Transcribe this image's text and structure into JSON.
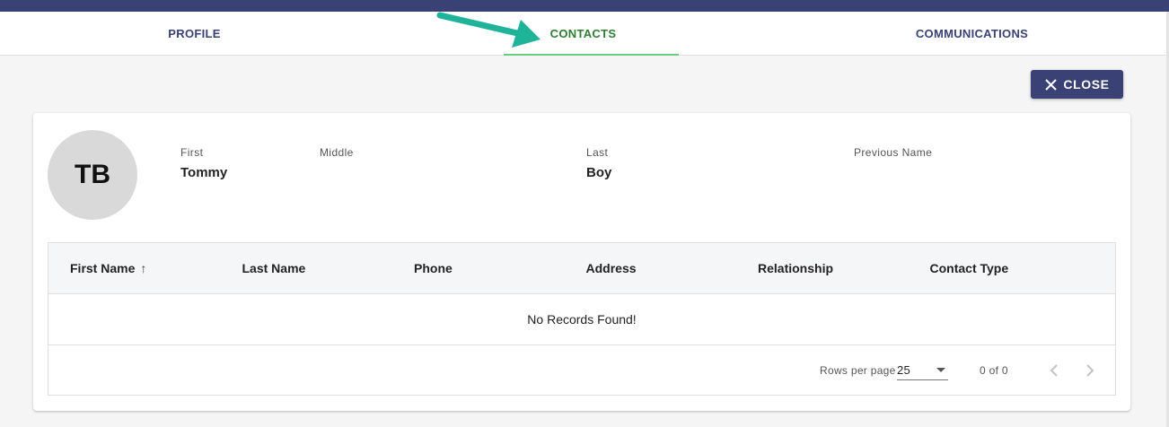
{
  "tabs": [
    {
      "label": "PROFILE",
      "active": false
    },
    {
      "label": "CONTACTS",
      "active": true
    },
    {
      "label": "COMMUNICATIONS",
      "active": false
    }
  ],
  "close_button": {
    "label": "CLOSE",
    "icon": "close-icon"
  },
  "person": {
    "initials": "TB",
    "fields": [
      {
        "label": "First",
        "value": "Tommy"
      },
      {
        "label": "Middle",
        "value": ""
      },
      {
        "label": "Last",
        "value": "Boy"
      },
      {
        "label": "Previous Name",
        "value": ""
      }
    ]
  },
  "table": {
    "columns": [
      "First Name",
      "Last Name",
      "Phone",
      "Address",
      "Relationship",
      "Contact Type"
    ],
    "sorted_column_icon": "arrow-up-icon",
    "empty_message": "No Records Found!",
    "pagination": {
      "rows_per_page_label": "Rows per page",
      "rows_per_page_value": "25",
      "range_text": "0 of 0"
    }
  },
  "colors": {
    "brand": "#3a4175",
    "active_tab": "#2e7d32",
    "indicator": "#66cc88",
    "annotation_arrow": "#1fb39a"
  }
}
